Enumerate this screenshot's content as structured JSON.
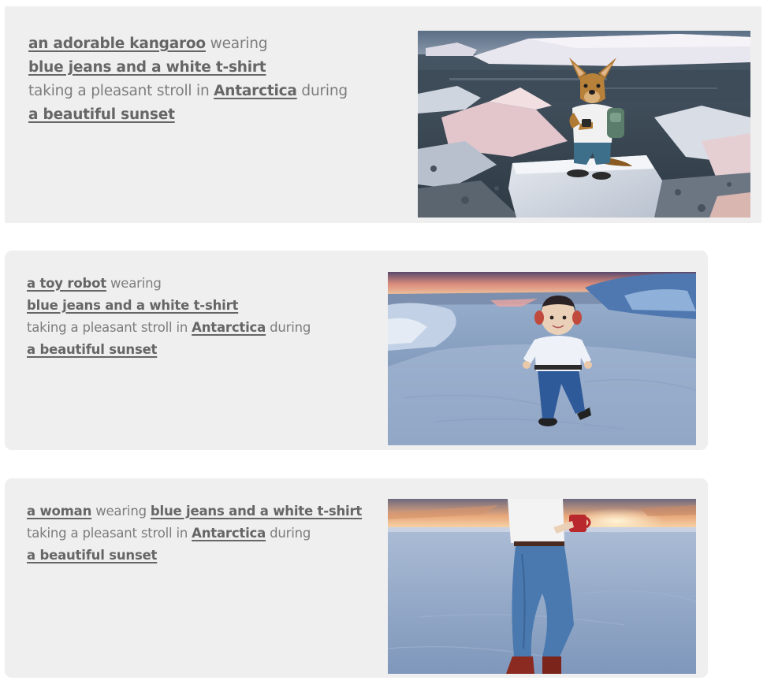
{
  "cards": [
    {
      "subject": "an adorable kangaroo",
      "w1": "wearing",
      "outfit": "blue jeans and a white t-shirt",
      "w2": "taking a pleasant stroll in",
      "place": "Antarctica",
      "w3": "during",
      "time": "a beautiful sunset",
      "image": "kangaroo-on-ice-image"
    },
    {
      "subject": "a toy robot",
      "w1": "wearing",
      "outfit": "blue jeans and a white t-shirt",
      "w2": "taking a pleasant stroll in",
      "place": "Antarctica",
      "w3": "during",
      "time": "a beautiful sunset",
      "image": "toy-robot-on-snow-image"
    },
    {
      "subject": "a woman",
      "w1": "wearing",
      "outfit": "blue jeans and a white t-shirt",
      "w2": "taking a pleasant stroll in",
      "place": "Antarctica",
      "w3": "during",
      "time": "a beautiful sunset",
      "image": "woman-walking-on-snow-image"
    }
  ],
  "colors": {
    "card_bg": "#efefef",
    "keyword_text": "#666666",
    "plain_text": "#7d7d7d"
  }
}
